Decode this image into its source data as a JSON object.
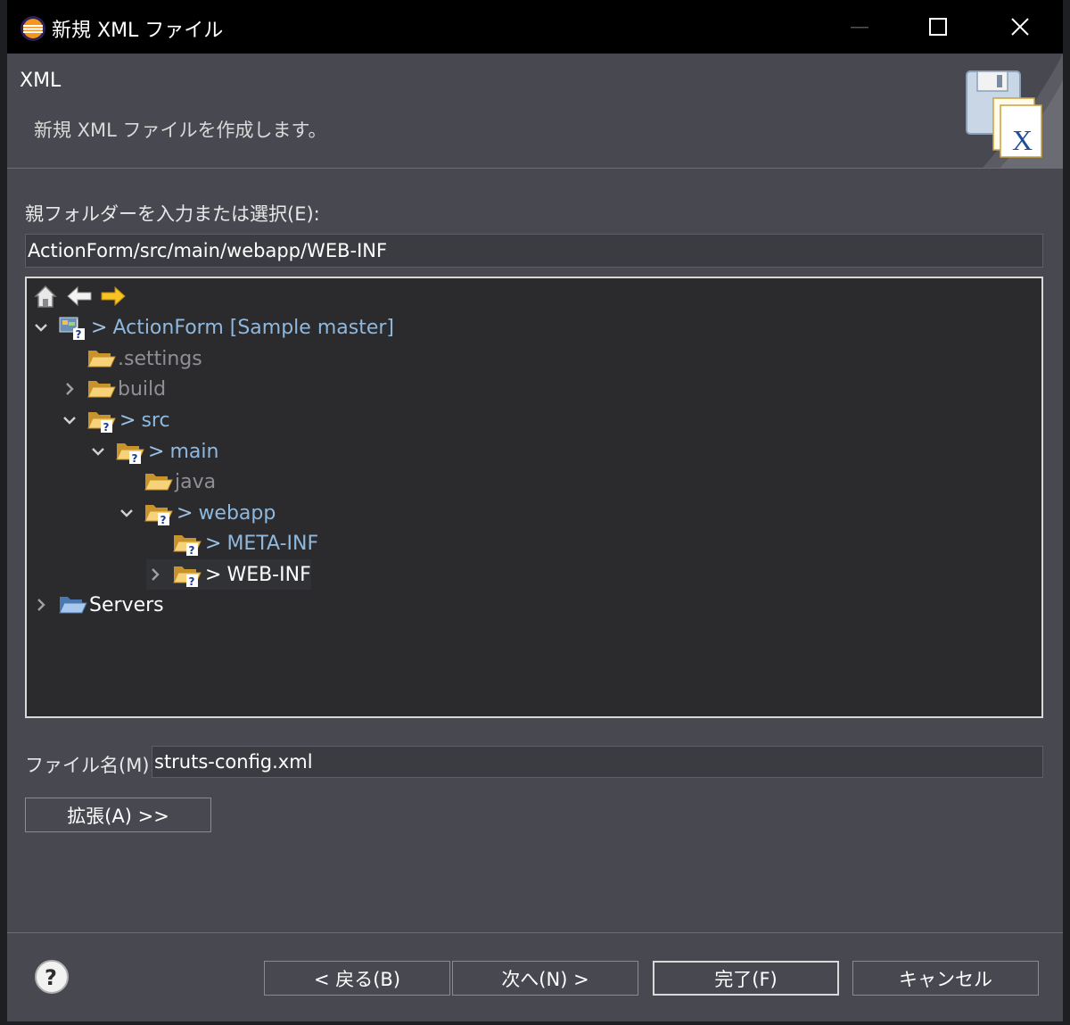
{
  "window": {
    "title": "新規 XML ファイル"
  },
  "header": {
    "title": "XML",
    "description": "新規 XML ファイルを作成します。"
  },
  "folder": {
    "label": "親フォルダーを入力または選択(E):",
    "value": "ActionForm/src/main/webapp/WEB-INF"
  },
  "tree": {
    "toolbar": {
      "home": "home-icon",
      "back": "arrow-left-icon",
      "forward": "arrow-right-icon"
    },
    "items": [
      {
        "label": "ActionForm [Sample master]",
        "deco": ">",
        "expanded": true
      },
      {
        "label": ".settings",
        "deco": ""
      },
      {
        "label": "build",
        "deco": "",
        "expanded": false
      },
      {
        "label": "src",
        "deco": ">",
        "expanded": true
      },
      {
        "label": "main",
        "deco": ">",
        "expanded": true
      },
      {
        "label": "java",
        "deco": ""
      },
      {
        "label": "webapp",
        "deco": ">",
        "expanded": true
      },
      {
        "label": "META-INF",
        "deco": ">"
      },
      {
        "label": "WEB-INF",
        "deco": ">",
        "expanded": false,
        "selected": true
      },
      {
        "label": "Servers",
        "deco": "",
        "expanded": false
      }
    ]
  },
  "filename": {
    "label": "ファイル名(M):",
    "value": "struts-config.xml"
  },
  "buttons": {
    "advanced": "拡張(A) >>",
    "back": "< 戻る(B)",
    "next": "次へ(N) >",
    "finish": "完了(F)",
    "cancel": "キャンセル"
  },
  "colors": {
    "accent_folder": "#f2c14e",
    "link_text": "#8fb8de",
    "selection": "#313235"
  }
}
